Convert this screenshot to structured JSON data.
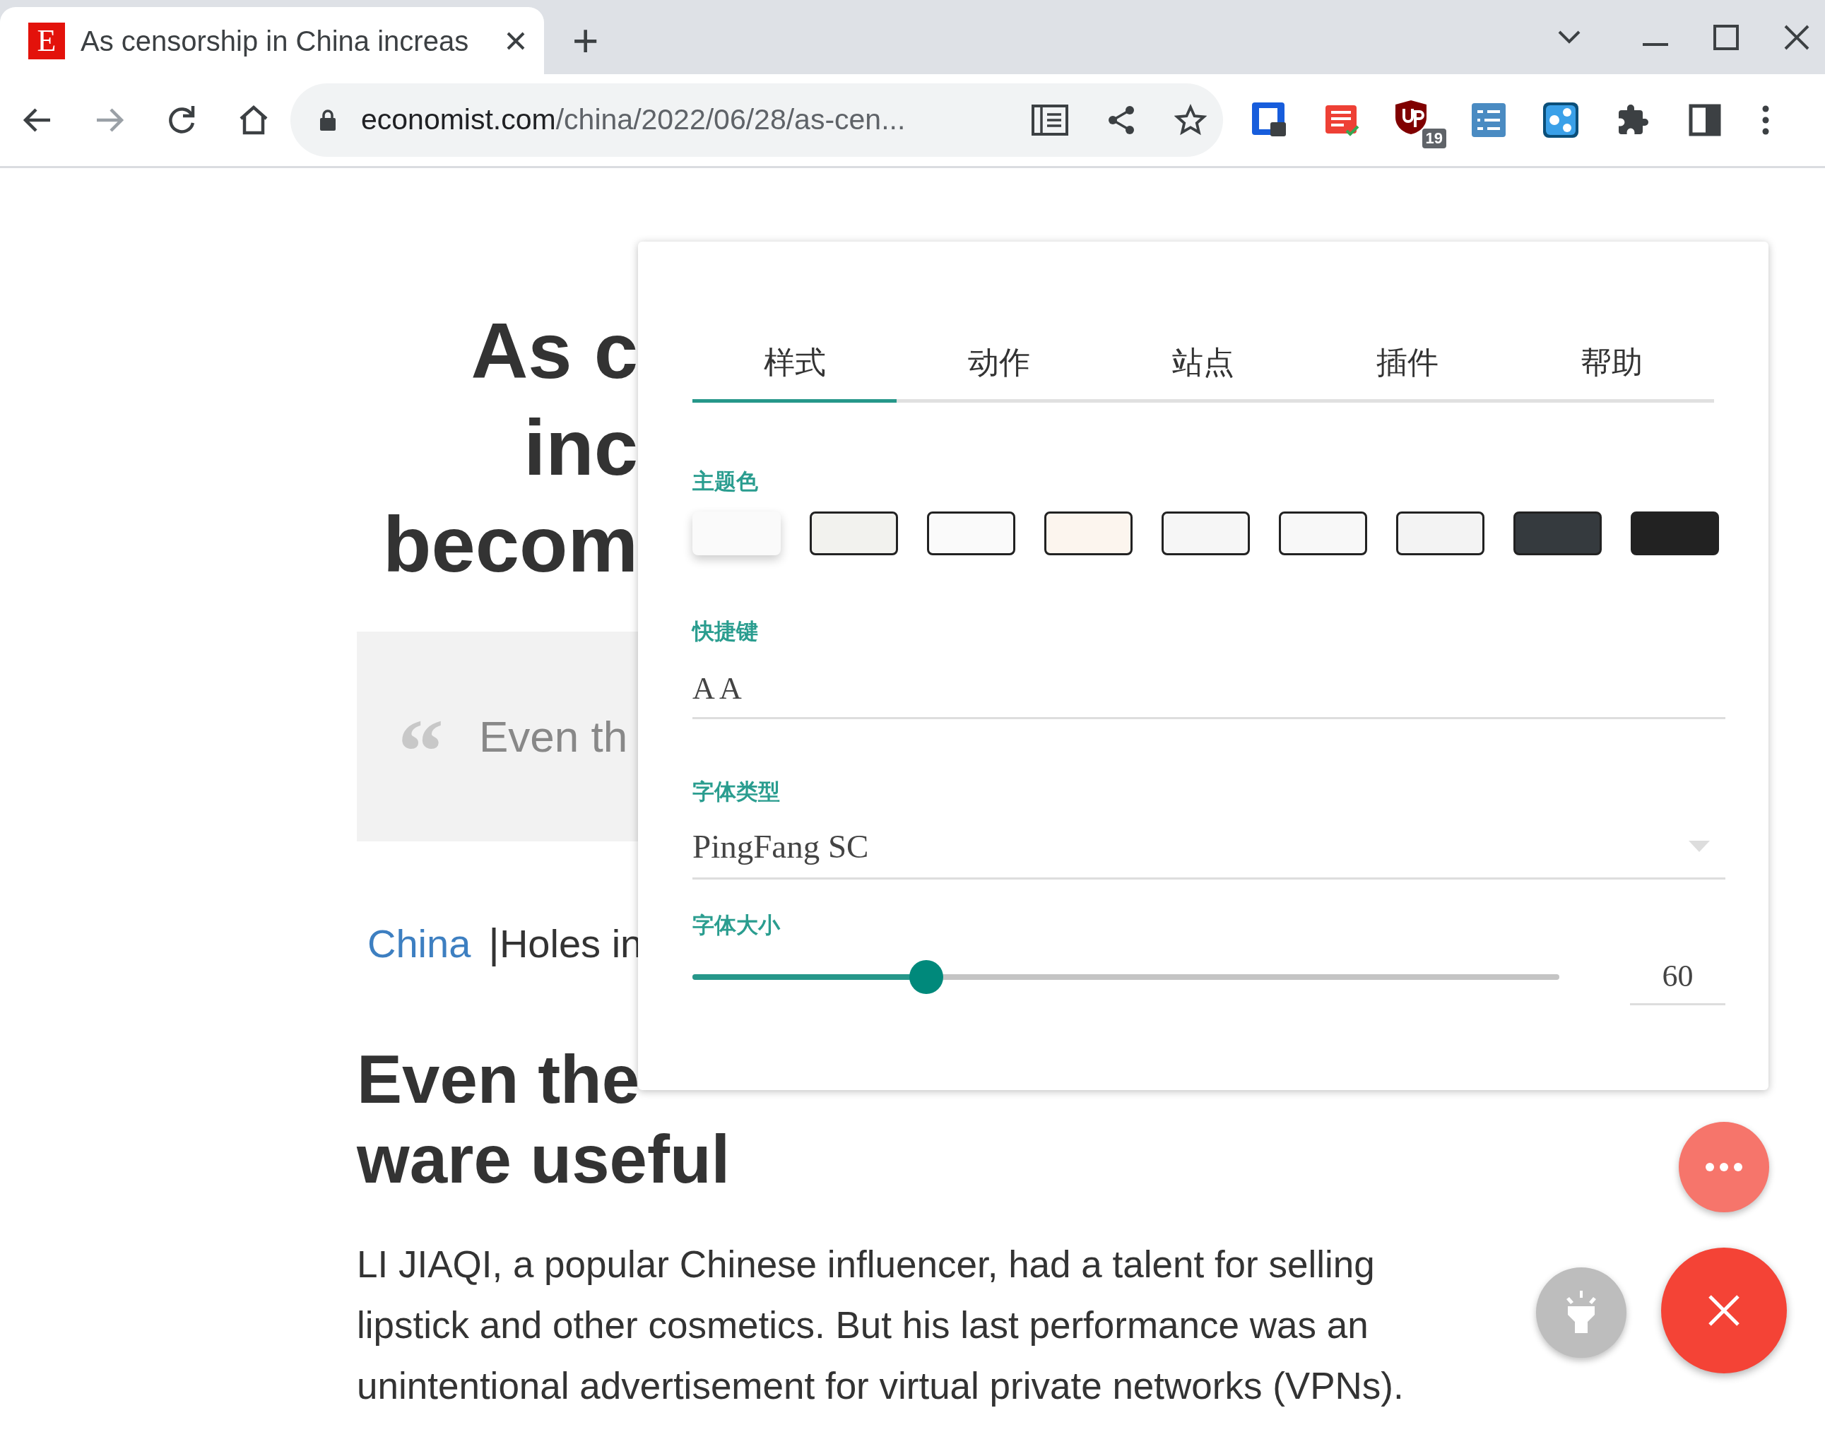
{
  "browser": {
    "tab": {
      "title": "As censorship in China increas",
      "favicon": "E"
    },
    "new_tab": "+",
    "address": {
      "domain": "economist.com",
      "path": "/china/2022/06/28/as-cen..."
    },
    "extension_badge": "19"
  },
  "article": {
    "headline": [
      "As c",
      "inc",
      "becom"
    ],
    "quote_mark": "“",
    "quote": "Even th",
    "section": "China",
    "separator": "|",
    "series": "Holes in",
    "subheading": [
      "Even the",
      "ware useful"
    ],
    "body": "LI JIAQI, a popular Chinese influencer, had a talent for selling lipstick and other cosmetics. But his last performance was an unintentional advertisement for virtual private networks (VPNs)."
  },
  "panel": {
    "tabs": [
      {
        "label": "样式",
        "selected": true
      },
      {
        "label": "动作",
        "selected": false
      },
      {
        "label": "站点",
        "selected": false
      },
      {
        "label": "插件",
        "selected": false
      },
      {
        "label": "帮助",
        "selected": false
      }
    ],
    "theme": {
      "label": "主题色",
      "swatches": [
        {
          "color": "#fafafa",
          "selected": true
        },
        {
          "color": "#f2f2ee",
          "selected": false
        },
        {
          "color": "#fafafa",
          "selected": false
        },
        {
          "color": "#fcf5ee",
          "selected": false
        },
        {
          "color": "#f6f6f6",
          "selected": false
        },
        {
          "color": "#f8f8f8",
          "selected": false
        },
        {
          "color": "#f3f3f3",
          "selected": false
        },
        {
          "color": "#353a3e",
          "selected": false
        },
        {
          "color": "#222222",
          "selected": false
        }
      ]
    },
    "shortcut": {
      "label": "快捷键",
      "value": "A A"
    },
    "font_type": {
      "label": "字体类型",
      "value": "PingFang SC"
    },
    "font_size": {
      "label": "字体大小",
      "level": 0.27,
      "value": "60"
    }
  }
}
